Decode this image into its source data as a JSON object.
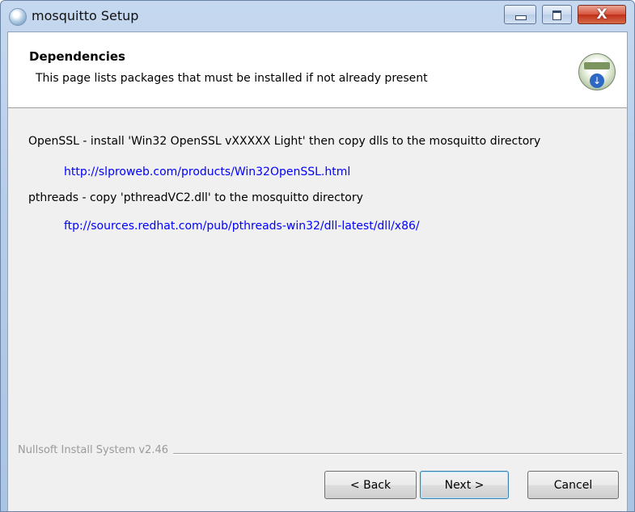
{
  "window": {
    "title": "mosquitto Setup",
    "controls": {
      "minimize": "",
      "maximize": "",
      "close": "X"
    }
  },
  "header": {
    "title": "Dependencies",
    "subtitle": "This page lists packages that must be installed if not already present",
    "icon": "installer-globe-icon"
  },
  "content": {
    "items": [
      {
        "text": "OpenSSL - install 'Win32 OpenSSL vXXXXX Light' then copy dlls to the mosquitto directory",
        "link": "http://slproweb.com/products/Win32OpenSSL.html"
      },
      {
        "text": "pthreads - copy 'pthreadVC2.dll' to the mosquitto directory",
        "link": "ftp://sources.redhat.com/pub/pthreads-win32/dll-latest/dll/x86/"
      }
    ]
  },
  "footer": {
    "branding": "Nullsoft Install System v2.46",
    "buttons": {
      "back": "< Back",
      "next": "Next >",
      "cancel": "Cancel"
    }
  },
  "colors": {
    "link": "#0000ff",
    "dialog_background": "#f0f0f0",
    "header_background": "#ffffff",
    "close_button": "#c7402a"
  }
}
